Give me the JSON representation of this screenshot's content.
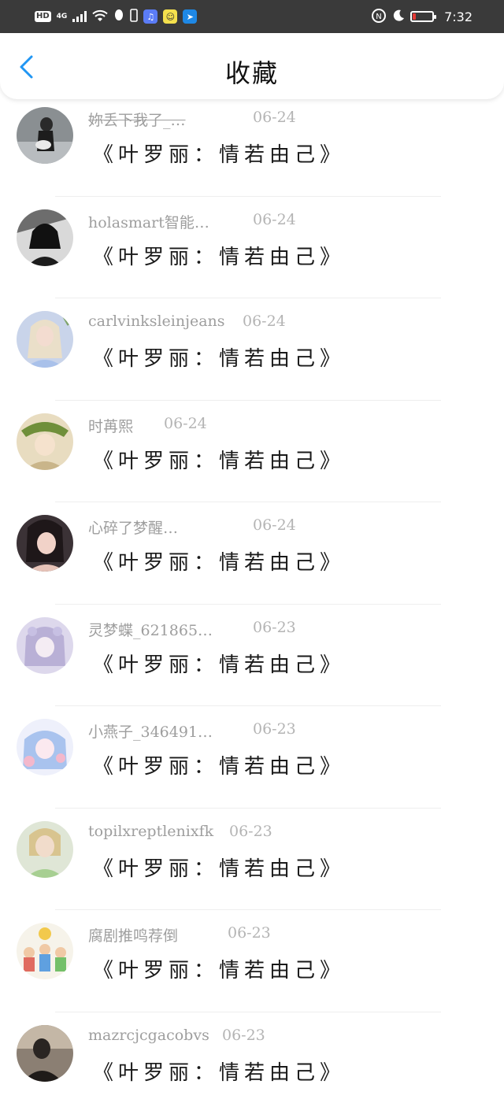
{
  "status_bar": {
    "hd": "HD",
    "network": "4G",
    "time": "7:32",
    "battery_level": 0.15,
    "icons": [
      "signal-icon",
      "wifi-icon",
      "qq-icon",
      "phone-icon",
      "music-app-icon",
      "emoji-app-icon",
      "maps-app-icon",
      "nfc-icon",
      "moon-icon",
      "battery-icon"
    ]
  },
  "header": {
    "title": "收藏",
    "back_icon": "chevron-left-icon",
    "accent_color": "#2196f3"
  },
  "items": [
    {
      "name": "妳丢下我了_…",
      "date": "06-24",
      "title": "《叶罗丽：情若由己》"
    },
    {
      "name": "holasmart智能…",
      "date": "06-24",
      "title": "《叶罗丽：情若由己》"
    },
    {
      "name": "carlvinksleinjeans",
      "date": "06-24",
      "title": "《叶罗丽：情若由己》"
    },
    {
      "name": "时苒熙",
      "date": "06-24",
      "title": "《叶罗丽：情若由己》"
    },
    {
      "name": "心碎了梦醒…",
      "date": "06-24",
      "title": "《叶罗丽：情若由己》"
    },
    {
      "name": "灵梦蝶_621865…",
      "date": "06-23",
      "title": "《叶罗丽：情若由己》"
    },
    {
      "name": "小燕子_346491…",
      "date": "06-23",
      "title": "《叶罗丽：情若由己》"
    },
    {
      "name": "topilxreptlenixfk",
      "date": "06-23",
      "title": "《叶罗丽：情若由己》"
    },
    {
      "name": "腐剧推鸣荐倒",
      "date": "06-23",
      "title": "《叶罗丽：情若由己》"
    },
    {
      "name": "mazrcjcgacobvs",
      "date": "06-23",
      "title": "《叶罗丽：情若由己》"
    }
  ]
}
